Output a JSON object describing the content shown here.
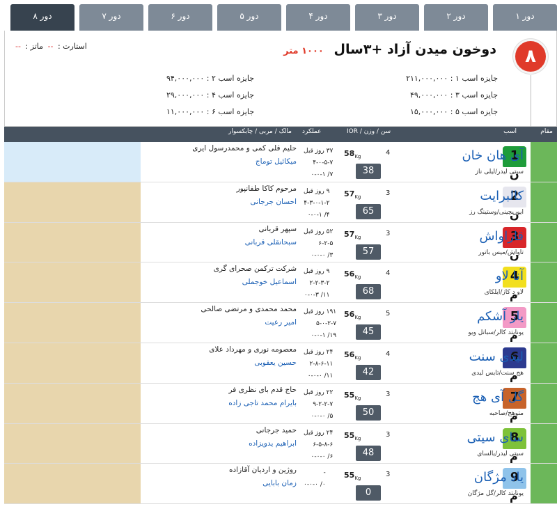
{
  "tabs": [
    "دور ۱",
    "دور ۲",
    "دور ۳",
    "دور ۴",
    "دور ۵",
    "دور ۶",
    "دور ۷",
    "دور ۸"
  ],
  "active_tab_index": 7,
  "race": {
    "number": "۸",
    "title": "دوخون میدن آزاد +۳سال",
    "distance": "۱۰۰۰ متر",
    "start_label": "استارت :",
    "start_value": "--",
    "matz_label": "ماتز :",
    "matz_value": "--",
    "prizes": {
      "p1": "جایزه اسب ۱ : ۲۱۱,۰۰۰,۰۰۰",
      "p2": "جایزه اسب ۲ : ۹۴,۰۰۰,۰۰۰",
      "p3": "جایزه اسب ۳ : ۴۹,۰۰۰,۰۰۰",
      "p4": "جایزه اسب ۴ : ۲۹,۰۰۰,۰۰۰",
      "p5": "جایزه اسب ۵ : ۱۵,۰۰۰,۰۰۰",
      "p6": "جایزه اسب ۶ : ۱۱,۰۰۰,۰۰۰"
    },
    "accent_color": "#e03a2a"
  },
  "table_header": {
    "rank": "مقام",
    "horse": "اسب",
    "age_weight_ior": "سن / وزن / IOR",
    "performance": "عملکرد",
    "owner_trainer_jockey": "مالک / مربی / چابکسوار"
  },
  "horses": [
    {
      "no": "1",
      "name": "آی هان خان",
      "pedigree": "سیتی لیدر/لیلی ناز",
      "sex": "ن",
      "age": "4",
      "weight": "58",
      "kg": "Kg",
      "ior": "38",
      "perf1": "۳۷ روز قبل",
      "perf2": "۴-۰-۵-۷",
      "perf3": "۷/ ۰-۰-۱",
      "owner": "حلیم قلی کمی و محمدرسول ایری",
      "jockey": "میکائیل توماج",
      "silk_color": "#1e9c3a",
      "left_bg": "blue"
    },
    {
      "no": "2",
      "name": "کالبرایت",
      "pedigree": "ایوریچینی/وستینگ رز",
      "sex": "ن",
      "age": "3",
      "weight": "57",
      "kg": "Kg",
      "ior": "65",
      "perf1": "۹ روز قبل",
      "perf2": "۴-۳-۰-۱-۲",
      "perf3": "۴/ ۰-۰-۱",
      "owner": "مرحوم کاکا طفانپور",
      "jockey": "احسان جرجانی",
      "silk_color": "#e6e6ee",
      "left_bg": "tan"
    },
    {
      "no": "3",
      "name": "قاراواش",
      "pedigree": "تاواش/میس باتور",
      "sex": "ن",
      "age": "3",
      "weight": "57",
      "kg": "Kg",
      "ior": "57",
      "perf1": "۵۲ روز قبل",
      "perf2": "۶-۲-۵",
      "perf3": "۳/ ۰-۰-۰",
      "owner": "سپهر قربانی",
      "jockey": "سبحانقلی قربانی",
      "silk_color": "#d8262a",
      "left_bg": "tan"
    },
    {
      "no": "4",
      "name": "آنا لاو",
      "pedigree": "لاو د کاز/ایلکای",
      "sex": "م",
      "age": "4",
      "weight": "56",
      "kg": "Kg",
      "ior": "68",
      "perf1": "۹ روز قبل",
      "perf2": "۲-۲-۳-۲",
      "perf3": "۱۱/ ۰-۰-۳",
      "owner": "شرکت ترکمن صحرای گری",
      "jockey": "اسماعیل خوجملی",
      "silk_color": "#f2df1e",
      "left_bg": "tan"
    },
    {
      "no": "5",
      "name": "یاز آشکم",
      "pedigree": "یونایتد کالر/سباتل ویو",
      "sex": "م",
      "age": "5",
      "weight": "56",
      "kg": "Kg",
      "ior": "45",
      "perf1": "۱۹۱ روز قبل",
      "perf2": "۵-۰-۲-۷",
      "perf3": "۱۹/ ۰-۰-۱",
      "owner": "محمد محمدی و مرتضی صالحی",
      "jockey": "امیر رعیت",
      "silk_color": "#f39ac6",
      "left_bg": "tan"
    },
    {
      "no": "6",
      "name": "لیدی سنت",
      "pedigree": "هج سنت/تایس لیدی",
      "sex": "م",
      "age": "4",
      "weight": "56",
      "kg": "Kg",
      "ior": "42",
      "perf1": "۲۴ روز قبل",
      "perf2": "۲-۸-۶-۱۱",
      "perf3": "۱۱/ ۰-۰-۰",
      "owner": "معصومه نوری و مهرداد علای",
      "jockey": "حسین یعقوبی",
      "silk_color": "#2c3a8f",
      "left_bg": "tan"
    },
    {
      "no": "7",
      "name": "گل آی هج",
      "pedigree": "متوهج/صاحبه",
      "sex": "م",
      "age": "3",
      "weight": "55",
      "kg": "Kg",
      "ior": "50",
      "perf1": "۲۲ روز قبل",
      "perf2": "۹-۲-۲-۷",
      "perf3": "۵/ ۰-۰-۰",
      "owner": "حاج قدم بای نظری فر",
      "jockey": "بایرام محمد تاجی زاده",
      "silk_color": "#c7632a",
      "left_bg": "tan"
    },
    {
      "no": "8",
      "name": "سای سیتی",
      "pedigree": "سیتی لیدر/یالسای",
      "sex": "م",
      "age": "3",
      "weight": "55",
      "kg": "Kg",
      "ior": "48",
      "perf1": "۲۴ روز قبل",
      "perf2": "۶-۵-۸-۶",
      "perf3": "۶/ ۰-۰-۰",
      "owner": "حمید جرجانی",
      "jockey": "ابراهیم یدویزاده",
      "silk_color": "#7ec23a",
      "left_bg": "tan"
    },
    {
      "no": "9",
      "name": "یاد مژگان",
      "pedigree": "یونایتد کالر/گل مژگان",
      "sex": "م",
      "age": "3",
      "weight": "55",
      "kg": "Kg",
      "ior": "0",
      "perf1": "-",
      "perf2": "",
      "perf3": "۰/ ۰-۰-۰",
      "owner": "روژین و اردیان آقازاده",
      "jockey": "زمان بابایی",
      "silk_color": "#8fc3ea",
      "left_bg": "tan"
    }
  ]
}
